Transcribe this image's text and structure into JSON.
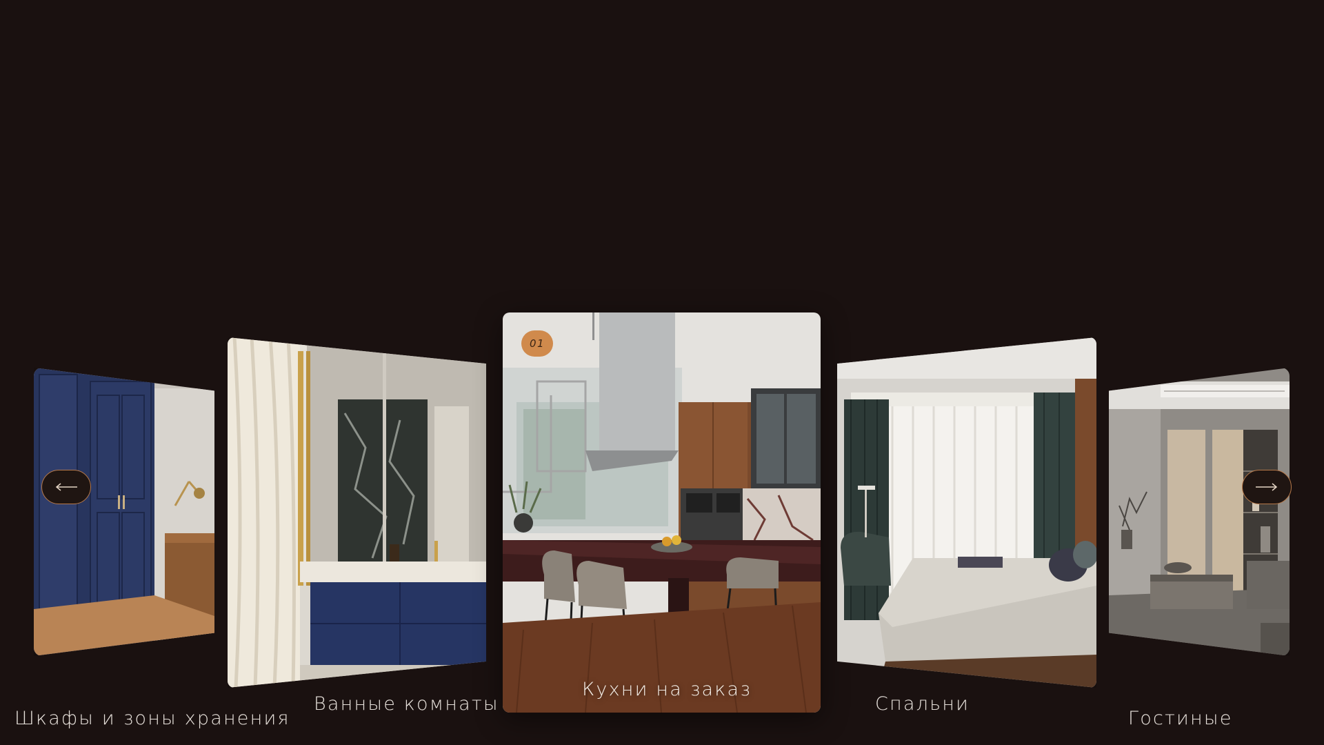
{
  "carousel": {
    "active_index_label": "01",
    "slides": [
      {
        "title": "Шкафы и зоны хранения"
      },
      {
        "title": "Ванные комнаты"
      },
      {
        "title": "Кухни на заказ"
      },
      {
        "title": "Спальни"
      },
      {
        "title": "Гостиные"
      }
    ],
    "prev_icon": "arrow-left-icon",
    "next_icon": "arrow-right-icon"
  },
  "colors": {
    "background": "#1a1110",
    "accent": "#d08a4c",
    "caption": "#e8e2dc"
  }
}
